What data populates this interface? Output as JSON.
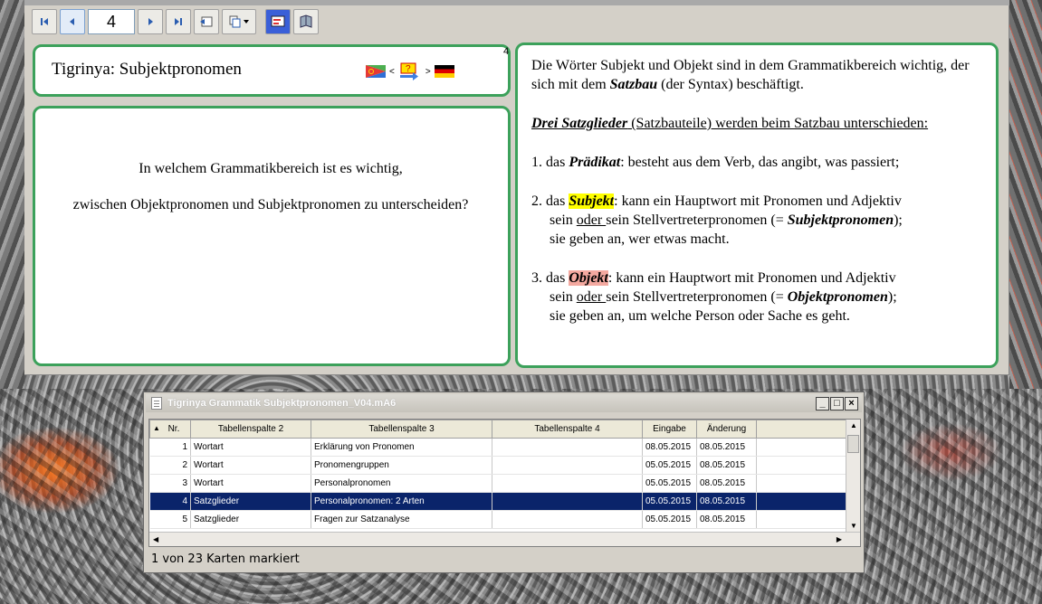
{
  "toolbar": {
    "page_number": "4",
    "buttons": [
      "first-page",
      "previous-page",
      "next-page",
      "last-page",
      "export",
      "copy",
      "flashcard",
      "book"
    ]
  },
  "card": {
    "number": "4",
    "title": "Tigrinya: Subjektpronomen",
    "flag_sep_left": "<",
    "flag_sep_right": ">",
    "question_line1": "In welchem Grammatikbereich ist es wichtig,",
    "question_line2": "zwischen Objektpronomen und Subjektpronomen zu unterscheiden?"
  },
  "answer": {
    "p1_a": "Die Wörter Subjekt und Objekt sind in dem Grammatikbereich wichtig, der sich mit dem ",
    "p1_b": "Satzbau",
    "p1_c": " (der Syntax) beschäftigt.",
    "p2_a": "Drei Satzglieder",
    "p2_b": " (Satzbauteile) werden beim Satzbau unterschieden:",
    "i1_num": "1. das ",
    "i1_term": "Prädikat",
    "i1_rest": ": besteht aus dem Verb, das angibt, was passiert;",
    "i2_num": "2. das ",
    "i2_term": "Subjekt",
    "i2_rest": ": kann ein Hauptwort mit Pronomen und Adjektiv",
    "i2_line2a": "sein ",
    "i2_oder": "oder ",
    "i2_line2b": "sein Stellvertreterpronomen (= ",
    "i2_em": "Subjektpronomen",
    "i2_line2c": ");",
    "i2_line3": "sie geben an, wer etwas macht.",
    "i3_num": "3. das ",
    "i3_term": "Objekt",
    "i3_rest": ": kann ein Hauptwort mit Pronomen und Adjektiv",
    "i3_line2a": "sein  ",
    "i3_oder": "oder ",
    "i3_line2b": "sein Stellvertreterpronomen (= ",
    "i3_em": "Objektpronomen",
    "i3_line2c": ");",
    "i3_line3": "sie geben an, um welche Person oder Sache es geht."
  },
  "grid_window": {
    "title": "Tigrinya Grammatik Subjektpronomen_V04.mA6",
    "columns": [
      "Nr.",
      "Tabellenspalte 2",
      "Tabellenspalte 3",
      "Tabellenspalte 4",
      "Eingabe",
      "Änderung"
    ],
    "rows": [
      {
        "nr": "1",
        "c2": "Wortart",
        "c3": "Erklärung von Pronomen",
        "c4": "",
        "eingabe": "08.05.2015",
        "aenderung": "08.05.2015"
      },
      {
        "nr": "2",
        "c2": "Wortart",
        "c3": "Pronomengruppen",
        "c4": "",
        "eingabe": "05.05.2015",
        "aenderung": "08.05.2015"
      },
      {
        "nr": "3",
        "c2": "Wortart",
        "c3": "Personalpronomen",
        "c4": "",
        "eingabe": "05.05.2015",
        "aenderung": "08.05.2015"
      },
      {
        "nr": "4",
        "c2": "Satzglieder",
        "c3": "Personalpronomen: 2 Arten",
        "c4": "",
        "eingabe": "05.05.2015",
        "aenderung": "08.05.2015"
      },
      {
        "nr": "5",
        "c2": "Satzglieder",
        "c3": "Fragen zur Satzanalyse",
        "c4": "",
        "eingabe": "05.05.2015",
        "aenderung": "08.05.2015"
      }
    ],
    "selected_row": 4,
    "status": "1 von 23 Karten markiert"
  },
  "colors": {
    "panel_border": "#3ca15b",
    "selection": "#0a246a",
    "highlight_subjekt": "#ffff00",
    "highlight_objekt": "#f4a9a0"
  }
}
